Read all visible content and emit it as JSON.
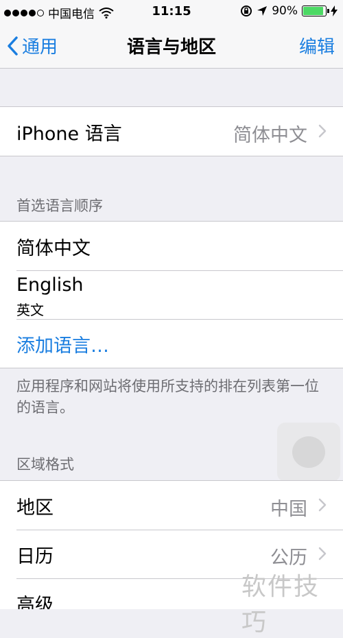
{
  "status_bar": {
    "carrier": "中国电信",
    "time": "11:15",
    "battery": "90%",
    "battery_level": 0.9
  },
  "nav": {
    "back_label": "通用",
    "title": "语言与地区",
    "edit_label": "编辑"
  },
  "iphone_language": {
    "label": "iPhone 语言",
    "value": "简体中文"
  },
  "preferred_languages": {
    "header": "首选语言顺序",
    "items": [
      {
        "label": "简体中文"
      },
      {
        "label": "English",
        "sublabel": "英文"
      }
    ],
    "add_label": "添加语言…",
    "footer": "应用程序和网站将使用所支持的排在列表第一位的语言。"
  },
  "region_format": {
    "header": "区域格式",
    "items": [
      {
        "label": "地区",
        "value": "中国"
      },
      {
        "label": "日历",
        "value": "公历"
      },
      {
        "label": "高级"
      }
    ]
  },
  "watermark": "软件技巧",
  "colors": {
    "accent": "#1a7ee0",
    "battery": "#4cd964",
    "background": "#efeff4"
  }
}
